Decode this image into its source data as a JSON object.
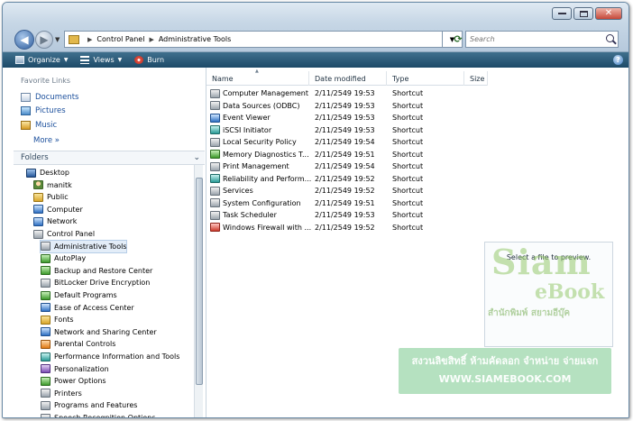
{
  "address": {
    "crumbs": [
      "Control Panel",
      "Administrative Tools"
    ]
  },
  "search": {
    "placeholder": "Search"
  },
  "toolbar": {
    "organize": "Organize",
    "views": "Views",
    "burn": "Burn"
  },
  "favorites": {
    "heading": "Favorite Links",
    "items": [
      "Documents",
      "Pictures",
      "Music"
    ],
    "more": "More »"
  },
  "folders": {
    "heading": "Folders",
    "tree": [
      {
        "label": "Desktop",
        "icon": "desktop-icon"
      },
      {
        "label": "manitk",
        "icon": "user-icon"
      },
      {
        "label": "Public",
        "icon": "folder-icon"
      },
      {
        "label": "Computer",
        "icon": "computer-icon"
      },
      {
        "label": "Network",
        "icon": "network-icon"
      },
      {
        "label": "Control Panel",
        "icon": "control-panel-icon"
      },
      {
        "label": "Administrative Tools",
        "icon": "admin-tools-icon"
      },
      {
        "label": "AutoPlay",
        "icon": "autoplay-icon"
      },
      {
        "label": "Backup and Restore Center",
        "icon": "backup-icon"
      },
      {
        "label": "BitLocker Drive Encryption",
        "icon": "bitlocker-icon"
      },
      {
        "label": "Default Programs",
        "icon": "default-programs-icon"
      },
      {
        "label": "Ease of Access Center",
        "icon": "ease-of-access-icon"
      },
      {
        "label": "Fonts",
        "icon": "fonts-icon"
      },
      {
        "label": "Network and Sharing Center",
        "icon": "network-sharing-icon"
      },
      {
        "label": "Parental Controls",
        "icon": "parental-controls-icon"
      },
      {
        "label": "Performance Information and Tools",
        "icon": "performance-icon"
      },
      {
        "label": "Personalization",
        "icon": "personalization-icon"
      },
      {
        "label": "Power Options",
        "icon": "power-icon"
      },
      {
        "label": "Printers",
        "icon": "printers-icon"
      },
      {
        "label": "Programs and Features",
        "icon": "programs-icon"
      },
      {
        "label": "Speech Recognition Options",
        "icon": "speech-icon"
      }
    ]
  },
  "columns": [
    "Name",
    "Date modified",
    "Type",
    "Size"
  ],
  "files": [
    {
      "name": "Computer Management",
      "date": "2/11/2549 19:53",
      "type": "Shortcut"
    },
    {
      "name": "Data Sources (ODBC)",
      "date": "2/11/2549 19:53",
      "type": "Shortcut"
    },
    {
      "name": "Event Viewer",
      "date": "2/11/2549 19:53",
      "type": "Shortcut"
    },
    {
      "name": "iSCSI Initiator",
      "date": "2/11/2549 19:53",
      "type": "Shortcut"
    },
    {
      "name": "Local Security Policy",
      "date": "2/11/2549 19:54",
      "type": "Shortcut"
    },
    {
      "name": "Memory Diagnostics T...",
      "date": "2/11/2549 19:51",
      "type": "Shortcut"
    },
    {
      "name": "Print Management",
      "date": "2/11/2549 19:54",
      "type": "Shortcut"
    },
    {
      "name": "Reliability and Perform...",
      "date": "2/11/2549 19:52",
      "type": "Shortcut"
    },
    {
      "name": "Services",
      "date": "2/11/2549 19:52",
      "type": "Shortcut"
    },
    {
      "name": "System Configuration",
      "date": "2/11/2549 19:51",
      "type": "Shortcut"
    },
    {
      "name": "Task Scheduler",
      "date": "2/11/2549 19:53",
      "type": "Shortcut"
    },
    {
      "name": "Windows Firewall with ...",
      "date": "2/11/2549 19:52",
      "type": "Shortcut"
    }
  ],
  "preview": {
    "message": "Select a file to preview."
  },
  "watermark": {
    "logo_word": "Siam",
    "logo_sub": "eBook",
    "logo_thai": "สำนักพิมพ์ สยามอีบุ๊ค",
    "notice": "สงวนลิขสิทธิ์ ห้ามคัดลอก จำหน่าย จ่ายแจก",
    "url": "WWW.SIAMEBOOK.COM"
  }
}
